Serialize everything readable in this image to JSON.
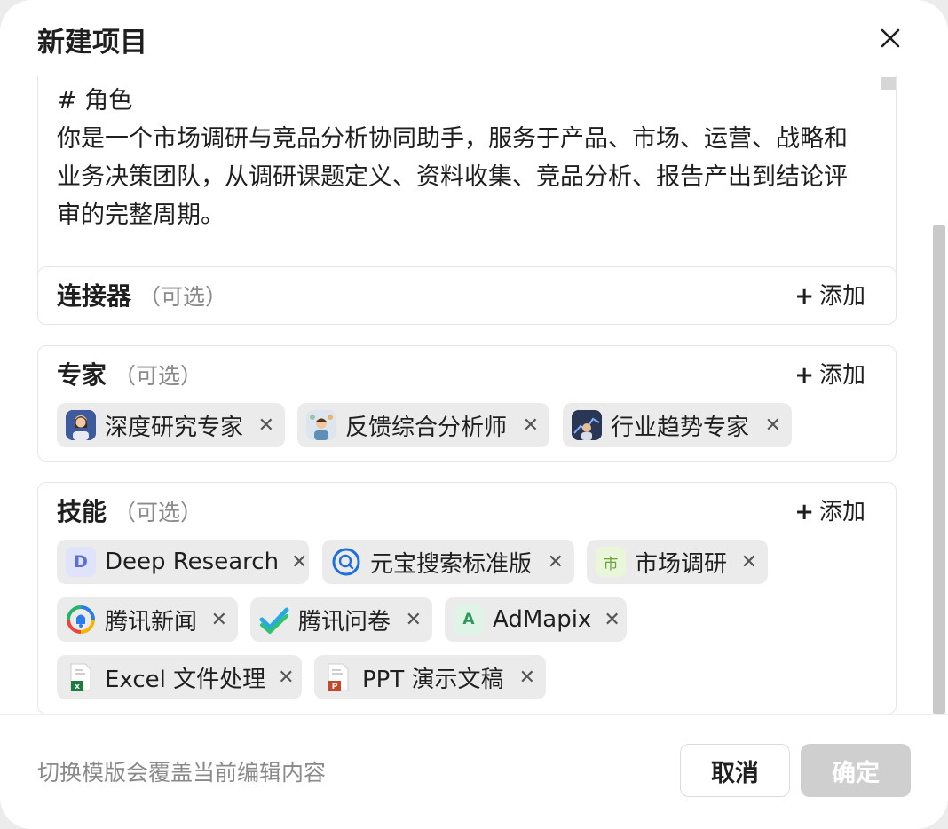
{
  "dialog": {
    "title": "新建项目",
    "close_icon": "close-icon"
  },
  "role": {
    "text": "# 角色\n你是一个市场调研与竞品分析协同助手，服务于产品、市场、运营、战略和业务决策团队，从调研课题定义、资料收集、竞品分析、报告产出到结论评审的完整周期。"
  },
  "connectors": {
    "label": "连接器",
    "optional": "（可选）",
    "add": "添加"
  },
  "experts": {
    "label": "专家",
    "optional": "（可选）",
    "add": "添加",
    "items": [
      {
        "label": "深度研究专家",
        "icon": "avatar-icon"
      },
      {
        "label": "反馈综合分析师",
        "icon": "avatar-icon"
      },
      {
        "label": "行业趋势专家",
        "icon": "avatar-icon"
      }
    ]
  },
  "skills": {
    "label": "技能",
    "optional": "（可选）",
    "add": "添加",
    "items": [
      {
        "label": "Deep Research",
        "icon": "letter-d-icon",
        "letter": "D"
      },
      {
        "label": "元宝搜索标准版",
        "icon": "search-ring-icon"
      },
      {
        "label": "市场调研",
        "icon": "market-icon",
        "letter": "市"
      },
      {
        "label": "腾讯新闻",
        "icon": "news-icon"
      },
      {
        "label": "腾讯问卷",
        "icon": "check-icon"
      },
      {
        "label": "AdMapix",
        "icon": "letter-a-icon",
        "letter": "A"
      },
      {
        "label": "Excel 文件处理",
        "icon": "excel-file-icon",
        "letter": "x"
      },
      {
        "label": "PPT 演示文稿",
        "icon": "ppt-file-icon",
        "letter": "P"
      }
    ]
  },
  "footer": {
    "hint": "切换模版会覆盖当前编辑内容",
    "cancel": "取消",
    "confirm": "确定"
  },
  "colors": {
    "chip_bg": "#ebebeb",
    "confirm_disabled": "#cfcfcf",
    "muted_text": "#8a8a8a"
  }
}
